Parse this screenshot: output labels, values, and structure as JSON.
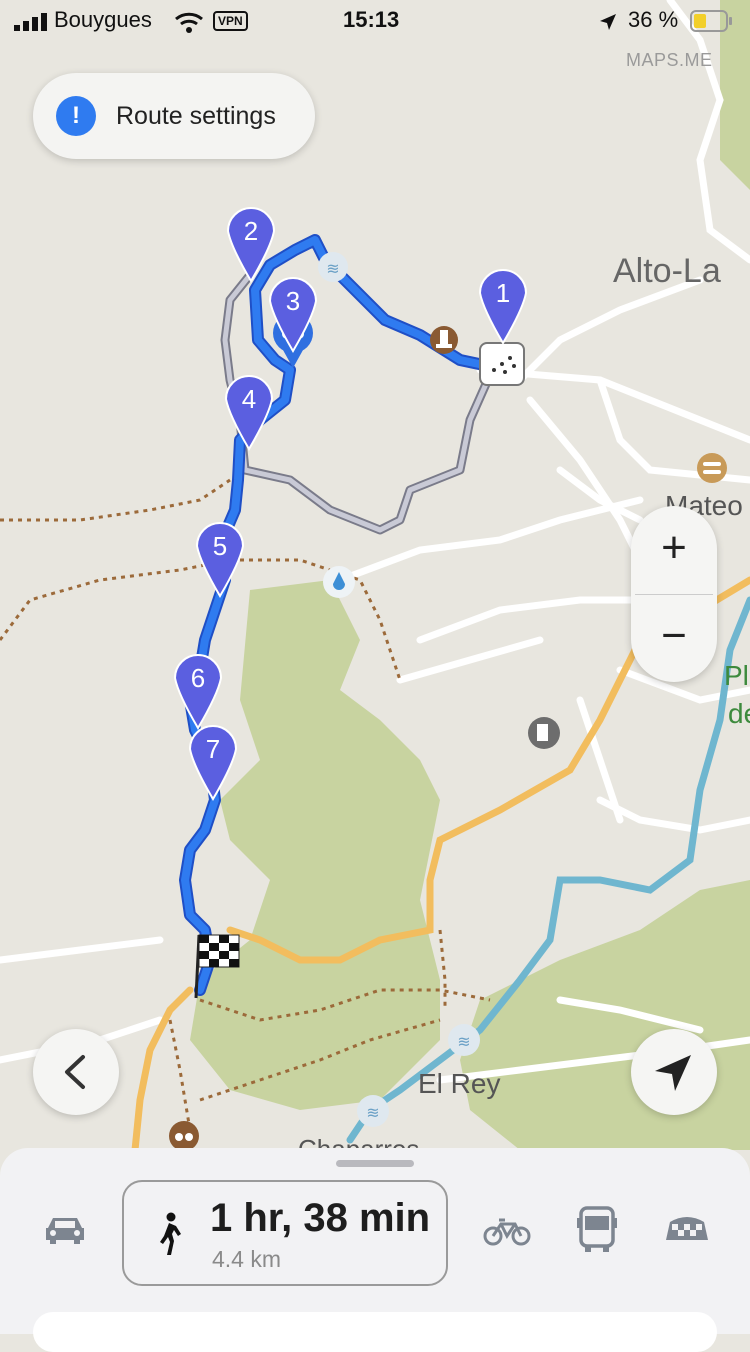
{
  "status_bar": {
    "carrier": "Bouygues",
    "vpn": "VPN",
    "time": "15:13",
    "battery": "36 %"
  },
  "map": {
    "watermark": "MAPS.ME",
    "labels": {
      "alto": "Alto-La",
      "mateo": "Mateo",
      "el_rey": "El Rey",
      "chaparro": "Chaparros",
      "right_green": "Pl",
      "right_green2": "de"
    },
    "waypoints": [
      "1",
      "2",
      "3",
      "4",
      "5",
      "6",
      "7"
    ],
    "colors": {
      "route": "#2f7bf0",
      "waypoint": "#5b5fe0",
      "park": "#c7d29c",
      "road_major": "#f2bd5e",
      "river": "#6fb6cf"
    }
  },
  "route_settings": {
    "label": "Route settings",
    "icon": "exclamation-icon"
  },
  "zoom": {
    "in": "+",
    "out": "−"
  },
  "bottom_sheet": {
    "modes": [
      "car-icon",
      "walk-icon",
      "bike-icon",
      "bus-icon",
      "taxi-icon"
    ],
    "selected_mode": "walk",
    "eta": "1 hr, 38 min",
    "distance": "4.4 km"
  }
}
